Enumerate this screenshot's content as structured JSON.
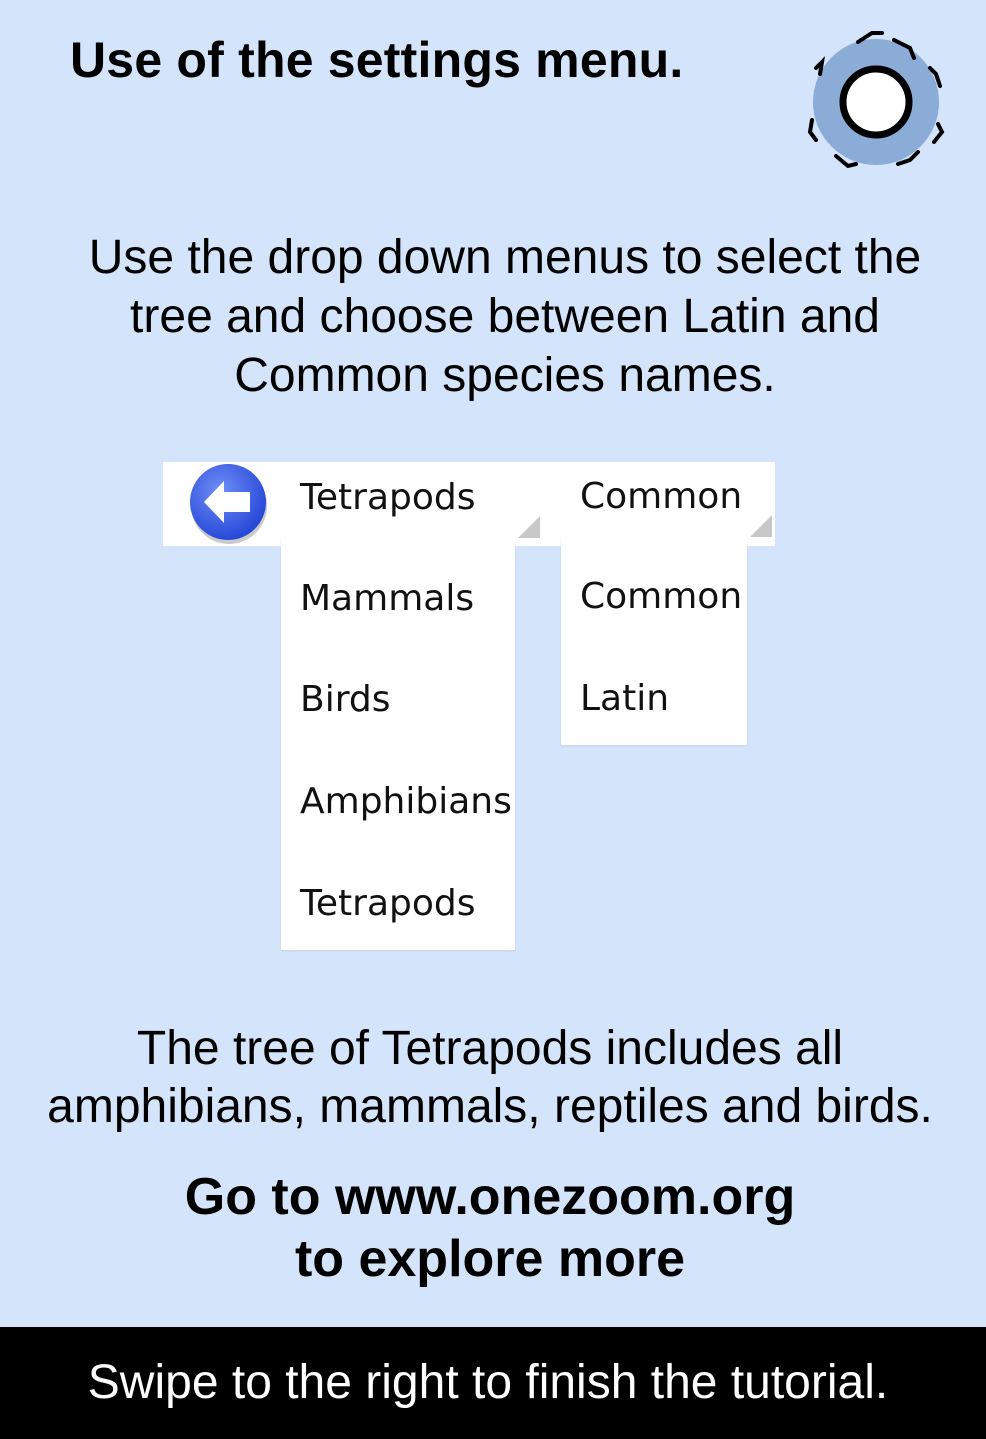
{
  "header": {
    "title": "Use of the settings menu.",
    "settings_icon": "gear-icon"
  },
  "intro": {
    "line1": "Use the drop down menus to select the",
    "line2": "tree and choose between Latin and",
    "line3": "Common species names."
  },
  "toolbar": {
    "back_icon": "arrow-left-icon",
    "tree_dropdown": {
      "selected": "Tetrapods",
      "options": [
        "Mammals",
        "Birds",
        "Amphibians",
        "Tetrapods"
      ]
    },
    "names_dropdown": {
      "selected": "Common",
      "options": [
        "Common",
        "Latin"
      ]
    }
  },
  "description": {
    "line1": "The tree of Tetrapods includes all",
    "line2": "amphibians, mammals, reptiles and birds."
  },
  "cta": {
    "line1": "Go to www.onezoom.org",
    "line2": "to explore more"
  },
  "footer": {
    "text": "Swipe to the right to finish the tutorial."
  },
  "colors": {
    "background": "#d3e4fb",
    "gear_fill": "#8bacd6",
    "back_button": "#3b5ee8",
    "footer": "#000000"
  }
}
